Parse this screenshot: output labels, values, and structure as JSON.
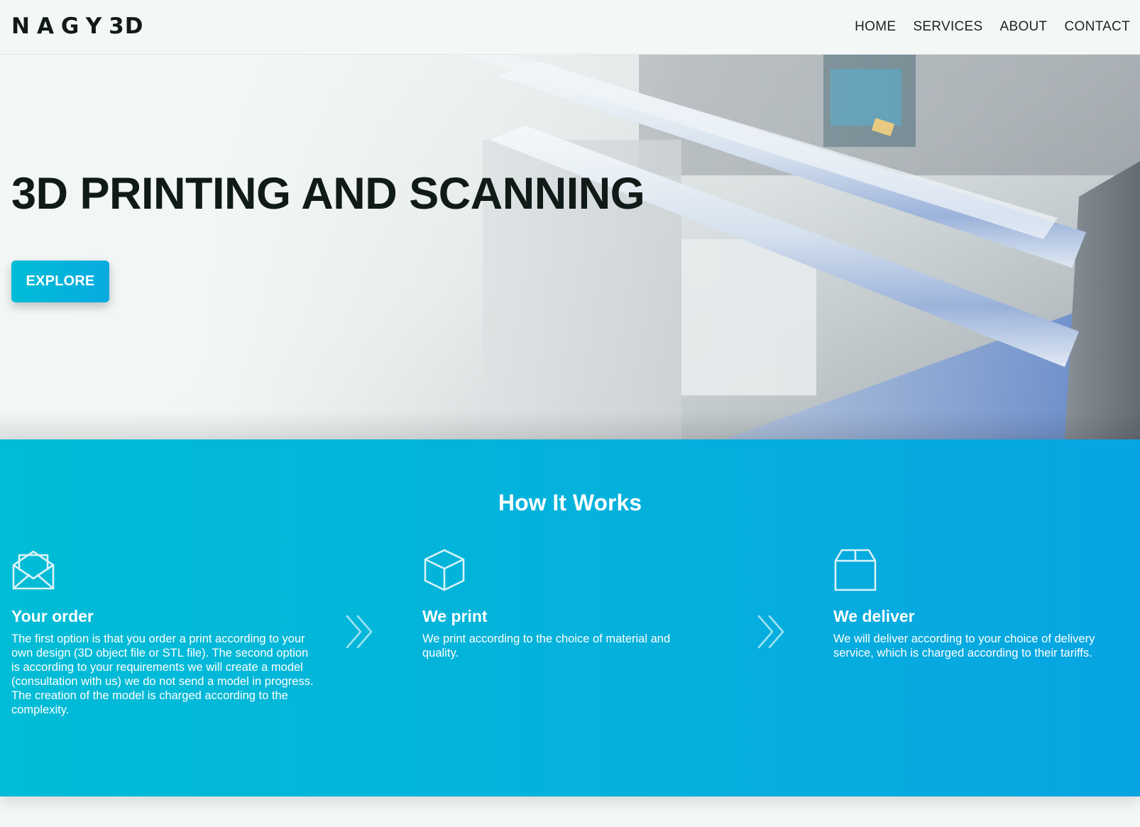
{
  "header": {
    "logo_main": "NAGY",
    "logo_suffix": "3D",
    "nav": [
      {
        "label": "HOME"
      },
      {
        "label": "SERVICES"
      },
      {
        "label": "ABOUT"
      },
      {
        "label": "CONTACT"
      }
    ]
  },
  "hero": {
    "title": "3D PRINTING AND SCANNING",
    "cta_label": "EXPLORE",
    "background": "3d-printer-photo"
  },
  "how_it_works": {
    "title": "How It Works",
    "steps": [
      {
        "icon": "open-envelope-icon",
        "title": "Your order",
        "text": "The first option is that you order a print according to your own design (3D object file or STL file). The second option is according to your requirements we will create a model (consultation with us) we do not send a model in progress. The creation of the model is charged according to the complexity."
      },
      {
        "icon": "cube-icon",
        "title": "We print",
        "text": "We print according to the choice of material and quality."
      },
      {
        "icon": "package-box-icon",
        "title": "We deliver",
        "text": "We will deliver according to your choice of delivery service, which is charged according to their tariffs."
      }
    ],
    "separator_icon": "double-chevron-right-icon"
  },
  "colors": {
    "accent_start": "#00bcd6",
    "accent_end": "#07a5e2",
    "text_dark": "#101a17",
    "page_bg": "#f3f7f6"
  }
}
